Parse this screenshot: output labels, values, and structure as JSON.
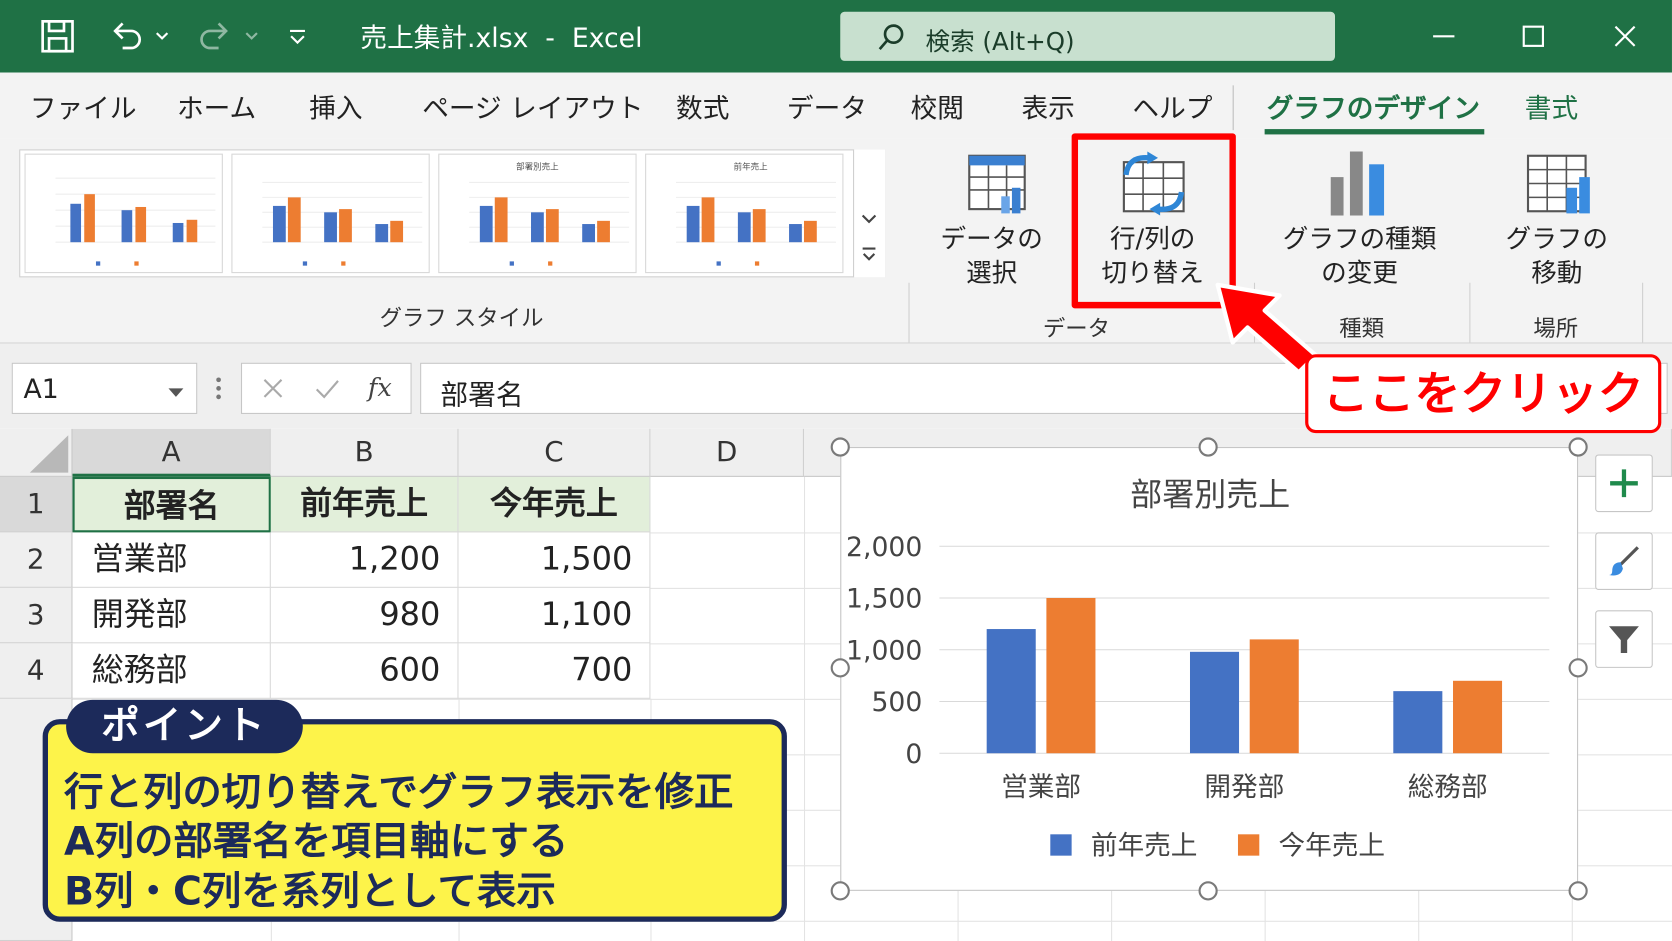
{
  "window": {
    "title": "売上集計.xlsx  -  Excel",
    "search_placeholder": "検索 (Alt+Q)"
  },
  "tabs": [
    "ファイル",
    "ホーム",
    "挿入",
    "ページ レイアウト",
    "数式",
    "データ",
    "校閲",
    "表示",
    "ヘルプ",
    "グラフのデザイン",
    "書式"
  ],
  "active_tab": "グラフのデザイン",
  "ribbon": {
    "chart_styles_label": "グラフ スタイル",
    "select_data": [
      "データの",
      "選択"
    ],
    "switch_row_col": [
      "行/列の",
      "切り替え"
    ],
    "data_group_label": "データ",
    "change_type": [
      "グラフの種類",
      "の変更"
    ],
    "type_group_label": "種類",
    "move_chart": [
      "グラフの",
      "移動"
    ],
    "location_group_label": "場所",
    "thumbnails": [
      {
        "title": ""
      },
      {
        "title": ""
      },
      {
        "title": "部署別売上"
      },
      {
        "title": "前年売上"
      }
    ]
  },
  "formula_bar": {
    "name_box": "A1",
    "content": "部署名",
    "fx": "fx"
  },
  "sheet": {
    "columns": [
      "A",
      "B",
      "C",
      "D"
    ],
    "rows": [
      "1",
      "2",
      "3",
      "4"
    ],
    "header": [
      "部署名",
      "前年売上",
      "今年売上"
    ],
    "data": [
      [
        "営業部",
        "1,200",
        "1,500"
      ],
      [
        "開発部",
        "980",
        "1,100"
      ],
      [
        "総務部",
        "600",
        "700"
      ]
    ]
  },
  "callout_click": "ここをクリック",
  "point": {
    "tag": "ポイント",
    "lines": [
      "行と列の切り替えでグラフ表示を修正",
      "A列の部署名を項目軸にする",
      "B列・C列を系列として表示"
    ]
  },
  "colors": {
    "excel_green": "#1f7145",
    "series_prev": "#4472c4",
    "series_curr": "#ed7d31",
    "highlight_red": "#ff0000",
    "point_yellow": "#fdf34a",
    "point_navy": "#1c2a5a"
  },
  "chart_data": {
    "type": "bar",
    "title": "部署別売上",
    "categories": [
      "営業部",
      "開発部",
      "総務部"
    ],
    "series": [
      {
        "name": "前年売上",
        "values": [
          1200,
          980,
          600
        ],
        "color": "#4472c4"
      },
      {
        "name": "今年売上",
        "values": [
          1500,
          1100,
          700
        ],
        "color": "#ed7d31"
      }
    ],
    "yticks": [
      "0",
      "500",
      "1,000",
      "1,500",
      "2,000"
    ],
    "ylim": [
      0,
      2000
    ],
    "grid": true,
    "legend": "bottom"
  },
  "icons": [
    "save-icon",
    "undo-icon",
    "redo-icon",
    "customize-icon",
    "search-icon",
    "minimize-icon",
    "maximize-icon",
    "close-icon",
    "add-element-icon",
    "brush-icon",
    "filter-icon"
  ]
}
